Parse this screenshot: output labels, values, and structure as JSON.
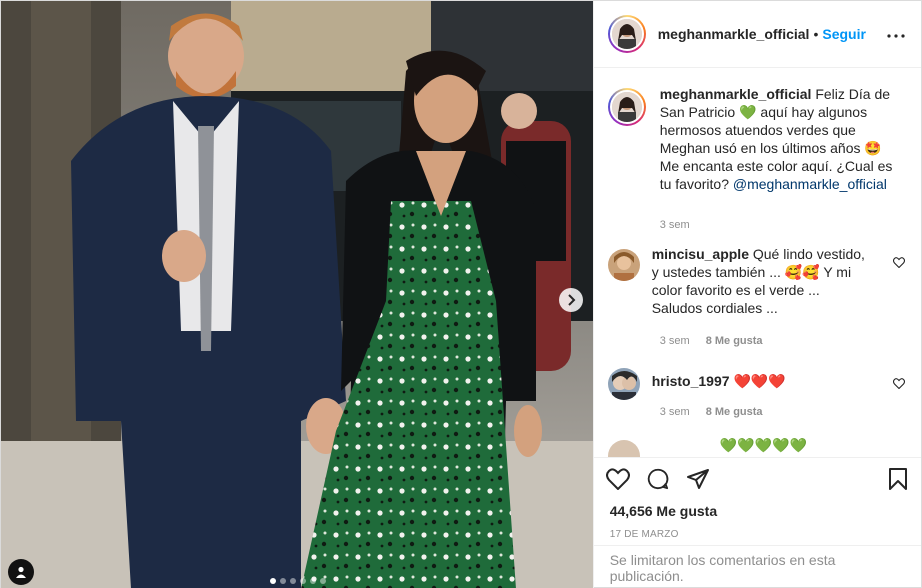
{
  "post": {
    "username": "meghanmarkle_official",
    "bullet": "•",
    "follow_label": "Seguir",
    "more_icon": "more-options-icon"
  },
  "caption": {
    "username": "meghanmarkle_official",
    "part1": "Feliz Día de San Patricio",
    "emoji1": "💚",
    "part2": "aquí hay algunos hermosos atuendos verdes que Meghan usó en los últimos años",
    "emoji2": "🤩",
    "part3": "Me encanta este color aquí. ¿Cual es tu favorito?",
    "mention": "@meghanmarkle_official",
    "time": "3 sem"
  },
  "comments": [
    {
      "username": "mincisu_apple",
      "part1": "Qué lindo vestido, y ustedes también ...",
      "emoji": "🥰🥰",
      "part2": "Y mi color favorito es el verde ... Saludos cordiales ...",
      "time": "3 sem",
      "likes": "8 Me gusta"
    },
    {
      "username": "hristo_1997",
      "emoji": "❤️❤️❤️",
      "time": "3 sem",
      "likes": "8 Me gusta"
    },
    {
      "partial_text": "💚💚💚💚💚"
    }
  ],
  "footer": {
    "likes": "44,656 Me gusta",
    "date": "17 de marzo",
    "comments_closed": "Se limitaron los comentarios en esta publicación."
  },
  "media": {
    "carousel_dots": 6,
    "active_dot": 0
  },
  "colors": {
    "accent": "#0095f6",
    "muted": "#8e8e8e",
    "dress_green": "#1f6b3a"
  }
}
